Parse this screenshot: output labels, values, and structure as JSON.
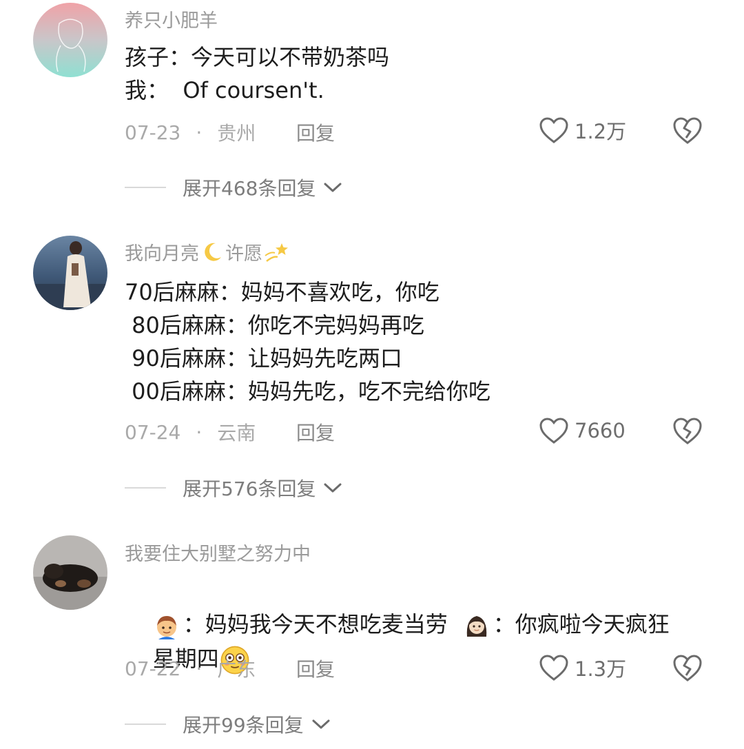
{
  "comments": [
    {
      "username": "养只小肥羊",
      "lines": [
        "孩子：今天可以不带奶茶吗",
        "我：  Of coursen't."
      ],
      "date": "07-23",
      "location": "贵州",
      "reply_label": "回复",
      "likes": "1.2万",
      "expand_label": "展开468条回复"
    },
    {
      "username": "我向月亮",
      "username_suffix": "许愿",
      "lines": [
        "70后麻麻：妈妈不喜欢吃，你吃",
        " 80后麻麻：你吃不完妈妈再吃",
        " 90后麻麻：让妈妈先吃两口",
        " 00后麻麻：妈妈先吃，吃不完给你吃"
      ],
      "date": "07-24",
      "location": "云南",
      "reply_label": "回复",
      "likes": "7660",
      "expand_label": "展开576条回复"
    },
    {
      "username": "我要住大别墅之努力中",
      "line1_a": "：妈妈我今天不想吃麦当劳",
      "line1_b": "：你疯啦今天疯狂",
      "line2": "星期四",
      "date": "07-22",
      "location": "广东",
      "reply_label": "回复",
      "likes": "1.3万",
      "expand_label": "展开99条回复"
    }
  ],
  "icons": {
    "like": "heart-outline-icon",
    "dislike": "broken-heart-icon",
    "expand": "chevron-down-icon",
    "moon": "crescent-moon-emoji",
    "sparkle": "dizzy-star-emoji",
    "boy": "boy-emoji",
    "woman": "woman-emoji",
    "flushed": "flushed-face-emoji"
  }
}
